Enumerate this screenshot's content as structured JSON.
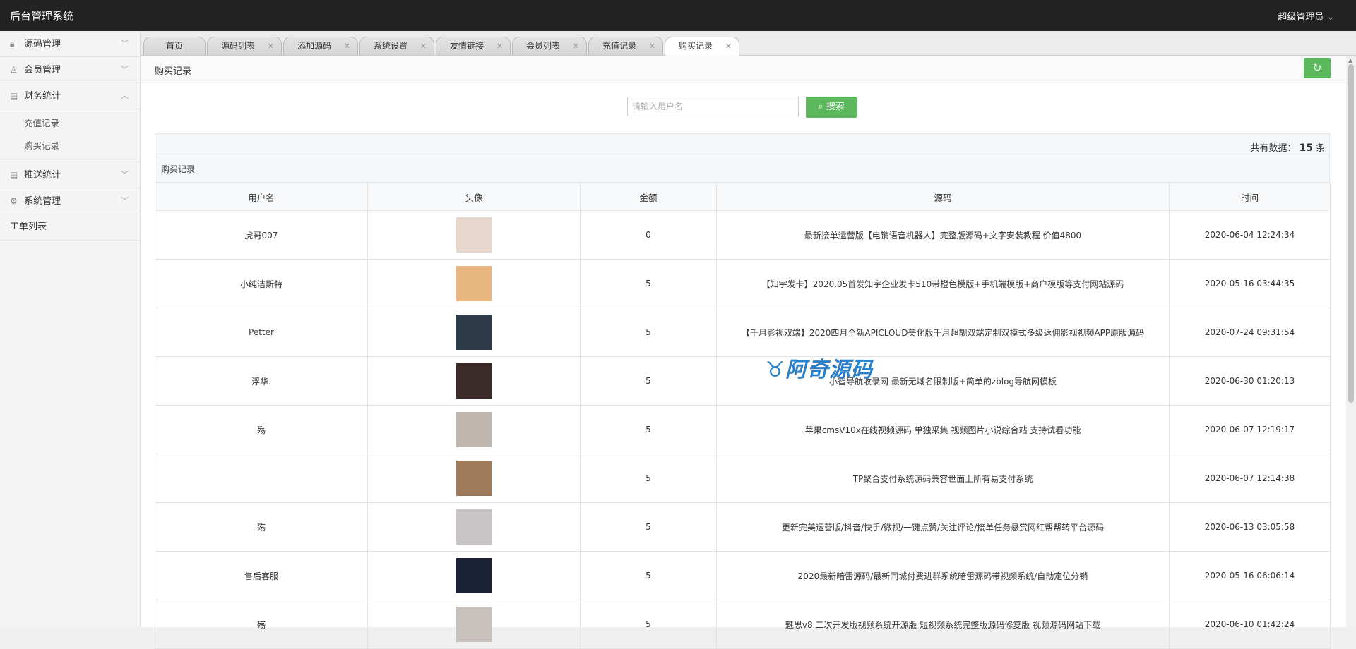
{
  "app": {
    "title": "后台管理系统",
    "user": "超级管理员"
  },
  "sidebar": {
    "items": [
      {
        "label": "源码管理",
        "icon": "lock-icon"
      },
      {
        "label": "会员管理",
        "icon": "user-icon"
      },
      {
        "label": "财务统计",
        "icon": "chart-icon",
        "expanded": true,
        "children": [
          "充值记录",
          "购买记录"
        ]
      },
      {
        "label": "推送统计",
        "icon": "chart-icon"
      },
      {
        "label": "系统管理",
        "icon": "gear-icon"
      },
      {
        "label": "工单列表"
      }
    ]
  },
  "tabs": [
    {
      "label": "首页"
    },
    {
      "label": "源码列表"
    },
    {
      "label": "添加源码"
    },
    {
      "label": "系统设置"
    },
    {
      "label": "友情链接"
    },
    {
      "label": "会员列表"
    },
    {
      "label": "充值记录"
    },
    {
      "label": "购买记录",
      "active": true
    }
  ],
  "page": {
    "title": "购买记录",
    "search_placeholder": "请输入用户名",
    "search_label": "搜索",
    "total_prefix": "共有数据：",
    "total_count": "15",
    "total_suffix": "条",
    "panel_title": "购买记录"
  },
  "table": {
    "columns": [
      "用户名",
      "头像",
      "金额",
      "源码",
      "时间"
    ],
    "rows": [
      {
        "user": "虎哥007",
        "avatar": "#e6d6cc",
        "amount": "0",
        "source": "最新接单运营版【电销语音机器人】完整版源码+文字安装教程 价值4800",
        "time": "2020-06-04 12:24:34"
      },
      {
        "user": "小纯洁斯特",
        "avatar": "#e8b680",
        "amount": "5",
        "source": "【知宇发卡】2020.05首发知宇企业发卡510带橙色模版+手机端模版+商户模版等支付网站源码",
        "time": "2020-05-16 03:44:35"
      },
      {
        "user": "Petter",
        "avatar": "#2e3b4a",
        "amount": "5",
        "source": "【千月影视双端】2020四月全新APICLOUD美化版千月超靓双端定制双模式多级返佣影视视频APP原版源码",
        "time": "2020-07-24 09:31:54"
      },
      {
        "user": "浮华.",
        "avatar": "#3a2a28",
        "amount": "5",
        "source": "小智导航收录网 最新无域名限制版+简单的zblog导航网模板",
        "time": "2020-06-30 01:20:13"
      },
      {
        "user": "殇",
        "avatar": "#bfb6b0",
        "amount": "5",
        "source": "苹果cmsV10x在线视频源码 单独采集 视频图片小说综合站 支持试看功能",
        "time": "2020-06-07 12:19:17"
      },
      {
        "user": "",
        "avatar": "#9c7a5a",
        "amount": "5",
        "source": "TP聚合支付系统源码兼容世面上所有易支付系统",
        "time": "2020-06-07 12:14:38"
      },
      {
        "user": "殇",
        "avatar": "#c9c4c6",
        "amount": "5",
        "source": "更新完美运营版/抖音/快手/微视/一键点赞/关注评论/接单任务悬赏网红帮帮转平台源码",
        "time": "2020-06-13 03:05:58"
      },
      {
        "user": "售后客服",
        "avatar": "#1c2236",
        "amount": "5",
        "source": "2020最新暗雷源码/最新同城付费进群系统暗雷源码带视频系统/自动定位分销",
        "time": "2020-05-16 06:06:14"
      },
      {
        "user": "殇",
        "avatar": "#c8c0bd",
        "amount": "5",
        "source": "魅思v8 二次开发版视频系统开源版 短视频系统完整版源码修复版 视频源码网站下载",
        "time": "2020-06-10 01:42:24"
      }
    ]
  },
  "watermark": "阿奇源码",
  "colors": {
    "topbar": "#222222",
    "accent": "#5cb85c",
    "watermark": "#2b7fc7"
  }
}
